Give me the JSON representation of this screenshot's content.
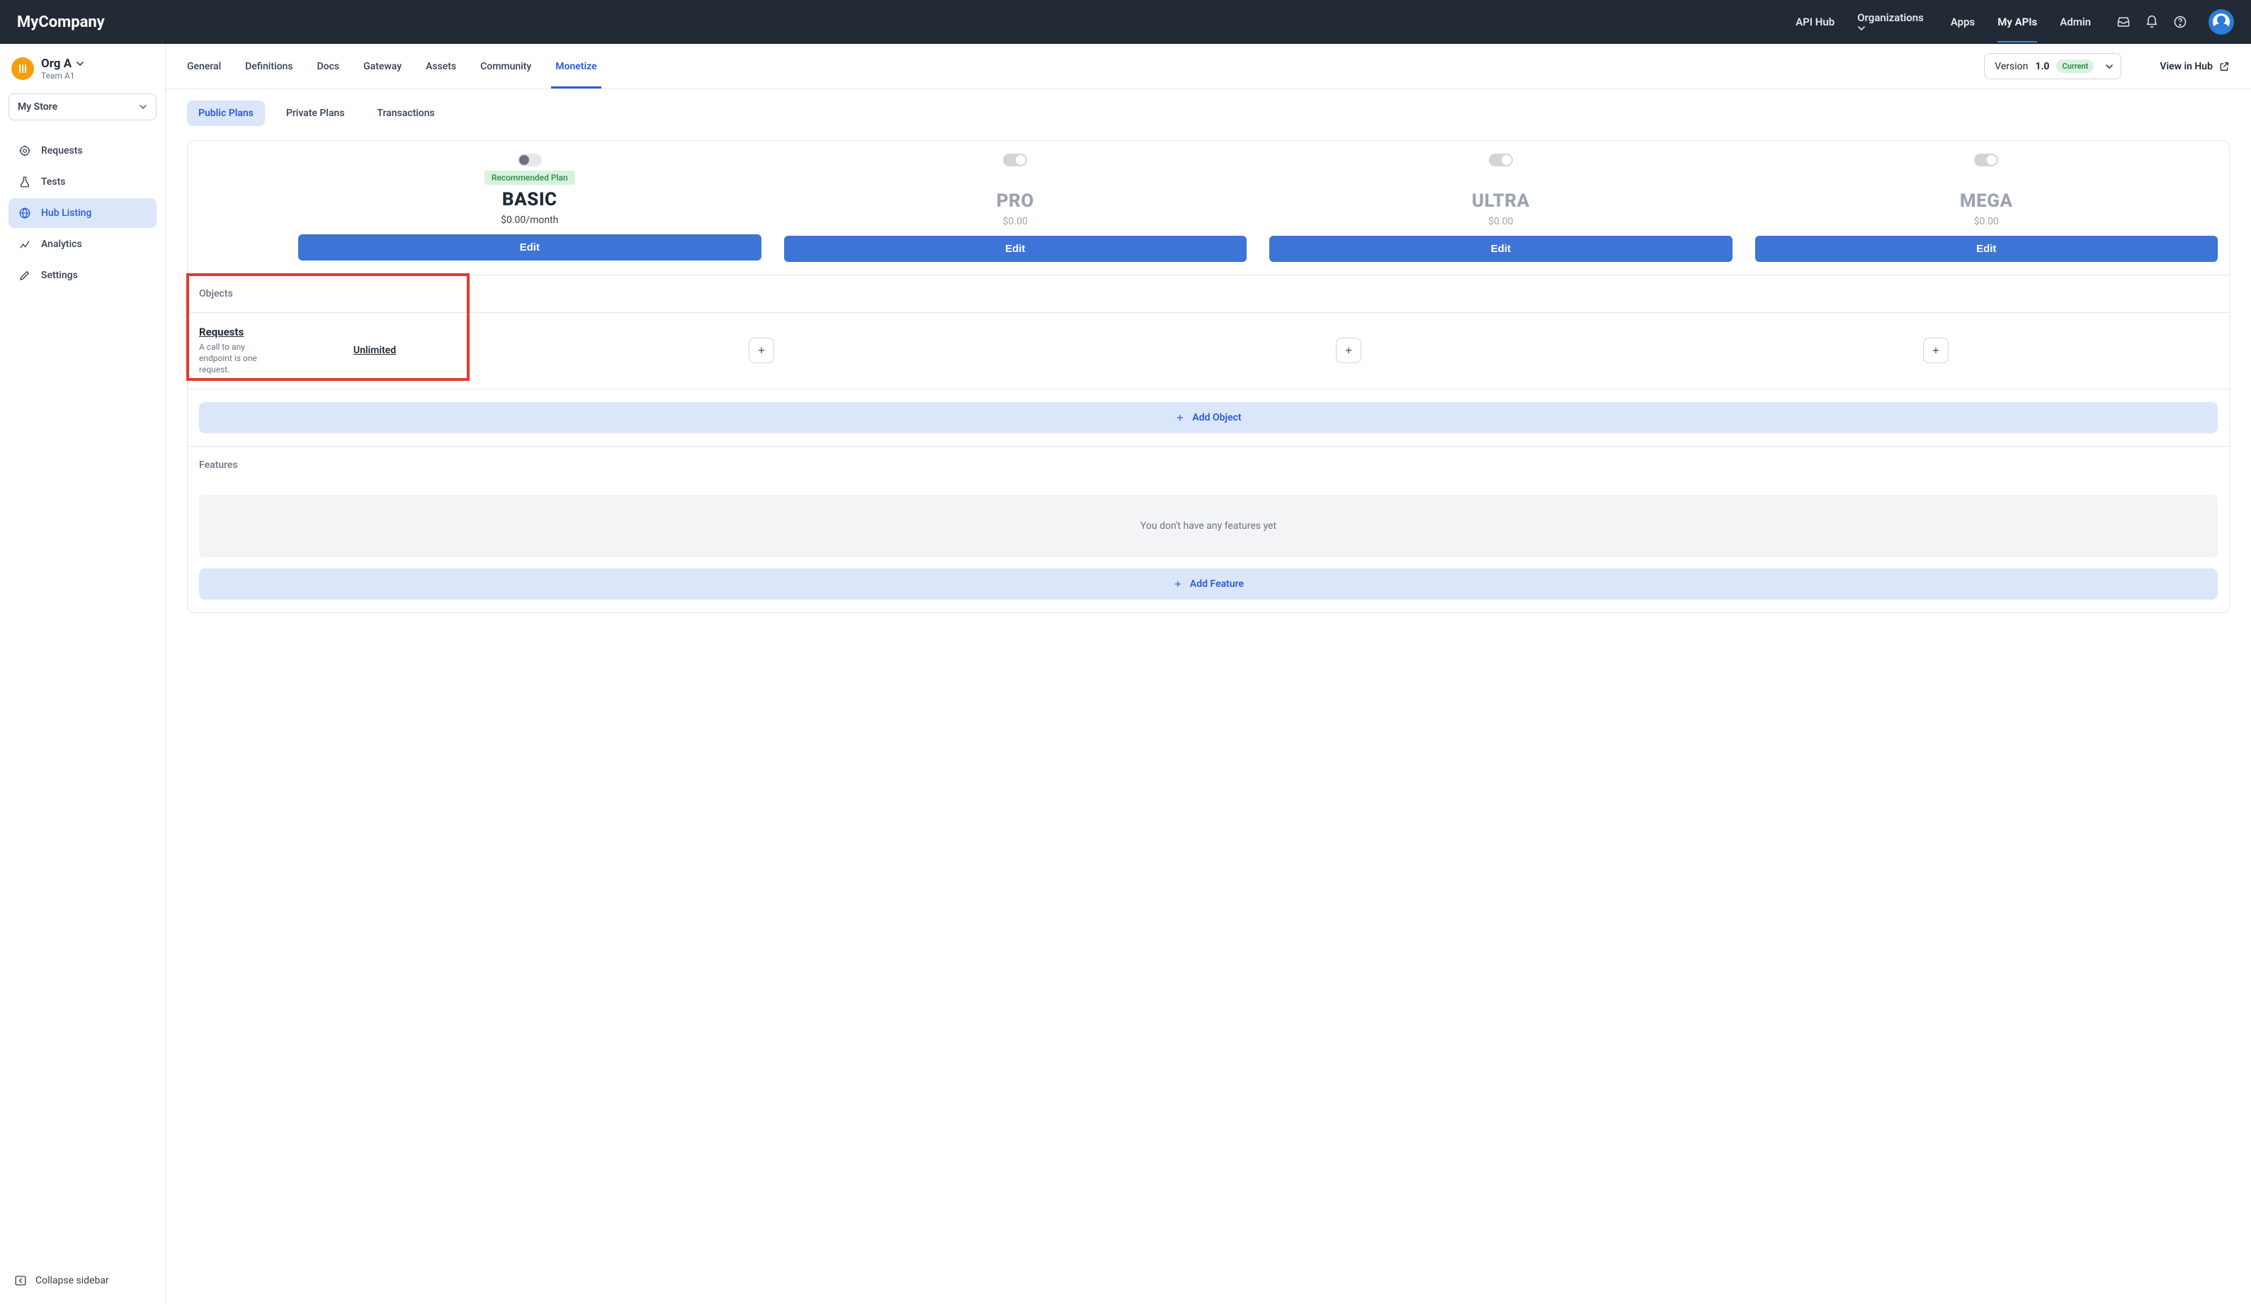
{
  "brand": "MyCompany",
  "topnav": {
    "links": [
      "API Hub",
      "Organizations",
      "Apps",
      "My APIs",
      "Admin"
    ],
    "active": "My APIs",
    "dropdown": "Organizations"
  },
  "org": {
    "name": "Org A",
    "team": "Team A1",
    "iconGlyph": "⦀"
  },
  "store_select": "My Store",
  "sidebar_items": [
    {
      "icon": "target",
      "label": "Requests"
    },
    {
      "icon": "flask",
      "label": "Tests"
    },
    {
      "icon": "globe",
      "label": "Hub Listing",
      "active": true
    },
    {
      "icon": "chart",
      "label": "Analytics"
    },
    {
      "icon": "pencil",
      "label": "Settings"
    }
  ],
  "collapse_label": "Collapse sidebar",
  "tabs": [
    "General",
    "Definitions",
    "Docs",
    "Gateway",
    "Assets",
    "Community",
    "Monetize"
  ],
  "active_tab": "Monetize",
  "version": {
    "prefix": "Version ",
    "value": "1.0",
    "badge": "Current"
  },
  "view_in_hub": "View in Hub",
  "subtabs": [
    "Public Plans",
    "Private Plans",
    "Transactions"
  ],
  "active_subtab": "Public Plans",
  "plans": [
    {
      "name": "BASIC",
      "price": "$0.00/month",
      "edit": "Edit",
      "toggle": "on",
      "recommended": "Recommended Plan",
      "active": true
    },
    {
      "name": "PRO",
      "price": "$0.00",
      "edit": "Edit",
      "toggle": "off",
      "active": false
    },
    {
      "name": "ULTRA",
      "price": "$0.00",
      "edit": "Edit",
      "toggle": "off",
      "active": false
    },
    {
      "name": "MEGA",
      "price": "$0.00",
      "edit": "Edit",
      "toggle": "off",
      "active": false
    }
  ],
  "objects_header": "Objects",
  "object_row": {
    "title": "Requests",
    "desc": "A call to any endpoint is one request.",
    "basic_value": "Unlimited"
  },
  "add_object": "Add Object",
  "features_header": "Features",
  "features_empty": "You don't have any features yet",
  "add_feature": "Add Feature"
}
